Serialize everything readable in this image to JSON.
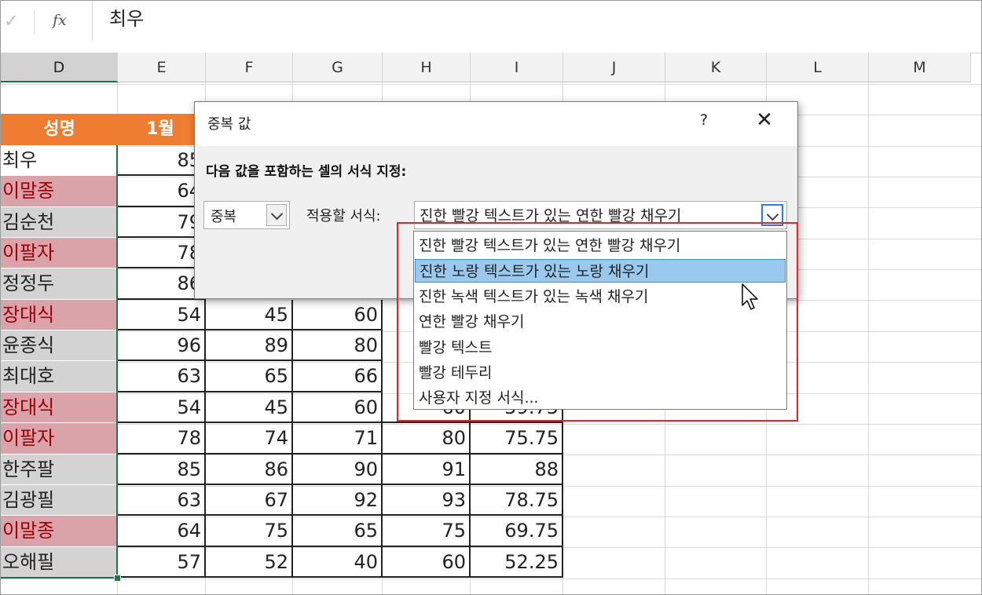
{
  "formula_bar": {
    "confirm_icon": "check-icon",
    "fx_label": "fx",
    "content": "최우"
  },
  "columns": [
    "D",
    "E",
    "F",
    "G",
    "H",
    "I",
    "J",
    "K",
    "L",
    "M"
  ],
  "header_row": {
    "name": "성명",
    "month1": "1월"
  },
  "rows": [
    {
      "name": "최우",
      "style": "white",
      "values": [
        "85",
        "",
        "",
        "",
        ""
      ]
    },
    {
      "name": "이말종",
      "style": "dup",
      "values": [
        "64",
        "",
        "",
        "",
        ""
      ]
    },
    {
      "name": "김순천",
      "style": "gray",
      "values": [
        "79",
        "",
        "",
        "",
        ""
      ]
    },
    {
      "name": "이팔자",
      "style": "dup",
      "values": [
        "78",
        "",
        "",
        "",
        ""
      ]
    },
    {
      "name": "정정두",
      "style": "gray",
      "values": [
        "86",
        "",
        "",
        "",
        ""
      ]
    },
    {
      "name": "장대식",
      "style": "dup",
      "values": [
        "54",
        "45",
        "60",
        "",
        ""
      ]
    },
    {
      "name": "윤종식",
      "style": "gray",
      "values": [
        "96",
        "89",
        "80",
        "",
        ""
      ]
    },
    {
      "name": "최대호",
      "style": "gray",
      "values": [
        "63",
        "65",
        "66",
        "",
        ""
      ]
    },
    {
      "name": "장대식",
      "style": "dup",
      "values": [
        "54",
        "45",
        "60",
        "60",
        "59.75"
      ]
    },
    {
      "name": "이팔자",
      "style": "dup",
      "values": [
        "78",
        "74",
        "71",
        "80",
        "75.75"
      ]
    },
    {
      "name": "한주팔",
      "style": "gray",
      "values": [
        "85",
        "86",
        "90",
        "91",
        "88"
      ]
    },
    {
      "name": "김광필",
      "style": "gray",
      "values": [
        "63",
        "67",
        "92",
        "93",
        "78.75"
      ]
    },
    {
      "name": "이말종",
      "style": "dup",
      "values": [
        "64",
        "75",
        "65",
        "75",
        "69.75"
      ]
    },
    {
      "name": "오해필",
      "style": "gray",
      "values": [
        "57",
        "52",
        "40",
        "60",
        "52.25"
      ]
    }
  ],
  "dialog": {
    "title": "중복 값",
    "help_label": "?",
    "close_label": "✕",
    "instruction": "다음 값을 포함하는 셀의 서식 지정:",
    "type_value": "중복",
    "apply_label": "적용할 서식:",
    "format_value": "진한 빨강 텍스트가 있는 연한 빨강 채우기"
  },
  "dropdown": {
    "items": [
      "진한 빨강 텍스트가 있는 연한 빨강 채우기",
      "진한 노랑 텍스트가 있는 노랑 채우기",
      "진한 녹색 텍스트가 있는 녹색 채우기",
      "연한 빨강 채우기",
      "빨강 텍스트",
      "빨강 테두리",
      "사용자 지정 서식..."
    ],
    "highlighted_index": 1
  },
  "colors": {
    "header_fill": "#ee7d31",
    "duplicate_fill": "#d9a3a9",
    "duplicate_text": "#9c0006",
    "gray_fill": "#d3d3d3",
    "selection": "#217346",
    "highlight": "#99c9ef",
    "annotation_box": "#e3222e"
  }
}
